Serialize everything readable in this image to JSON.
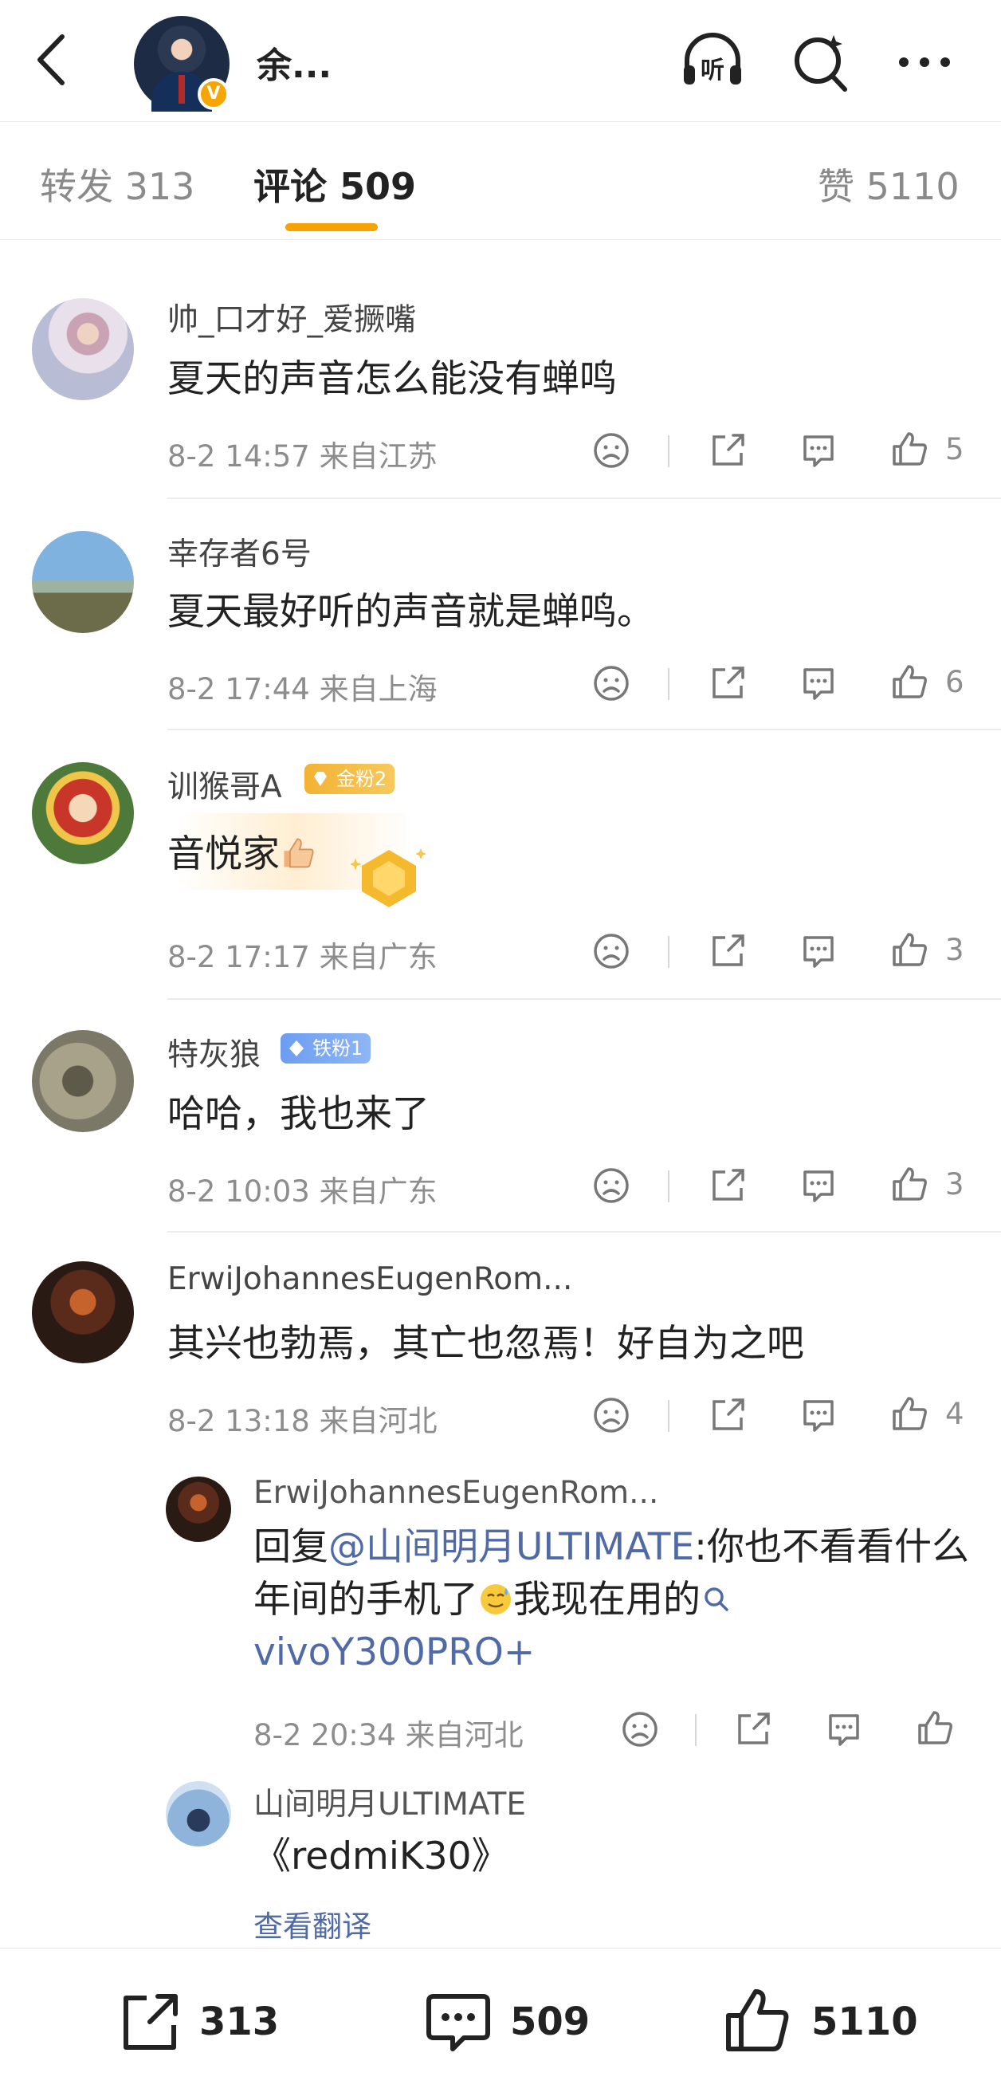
{
  "header": {
    "title": "余...",
    "verified_badge": "V",
    "icons": [
      "back-icon",
      "listen-icon",
      "ai-search-icon",
      "more-icon"
    ],
    "listen_label": "听"
  },
  "tabs": {
    "repost": "转发 313",
    "comments": "评论 509",
    "likes": "赞 5110",
    "active": "comments",
    "accent_color": "#f5a300"
  },
  "comments": [
    {
      "username": "帅_口才好_爱撅嘴",
      "text": "夏天的声音怎么能没有蝉鸣",
      "meta": "8-2 14:57 来自江苏",
      "likes": "5"
    },
    {
      "username": "幸存者6号",
      "text": "夏天最好听的声音就是蝉鸣。",
      "meta": "8-2 17:44 来自上海",
      "likes": "6"
    },
    {
      "username": "训猴哥A",
      "fan_badge": "金粉2",
      "text": "音悦家",
      "emoji": "thumbs-up",
      "meta": "8-2 17:17 来自广东",
      "likes": "3"
    },
    {
      "username": "特灰狼",
      "fan_badge": "铁粉1",
      "text": "哈哈，我也来了",
      "meta": "8-2 10:03 来自广东",
      "likes": "3"
    },
    {
      "username": "ErwiJohannesEugenRom...",
      "text": "其兴也勃焉，其亡也忽焉！好自为之吧",
      "meta": "8-2 13:18 来自河北",
      "likes": "4",
      "replies": [
        {
          "username": "ErwiJohannesEugenRom...",
          "prefix": "回复",
          "mention": "@山间明月ULTIMATE",
          "body": ":你也不看看什么年间的手机了",
          "body2": "我现在用的",
          "search_link": "vivoY300PRO+",
          "meta": "8-2 20:34 来自河北"
        },
        {
          "username": "山间明月ULTIMATE",
          "text": "《redmiK30》",
          "translate": "查看翻译"
        }
      ]
    }
  ],
  "bottom_bar": {
    "reposts": "313",
    "comments": "509",
    "likes": "5110"
  }
}
